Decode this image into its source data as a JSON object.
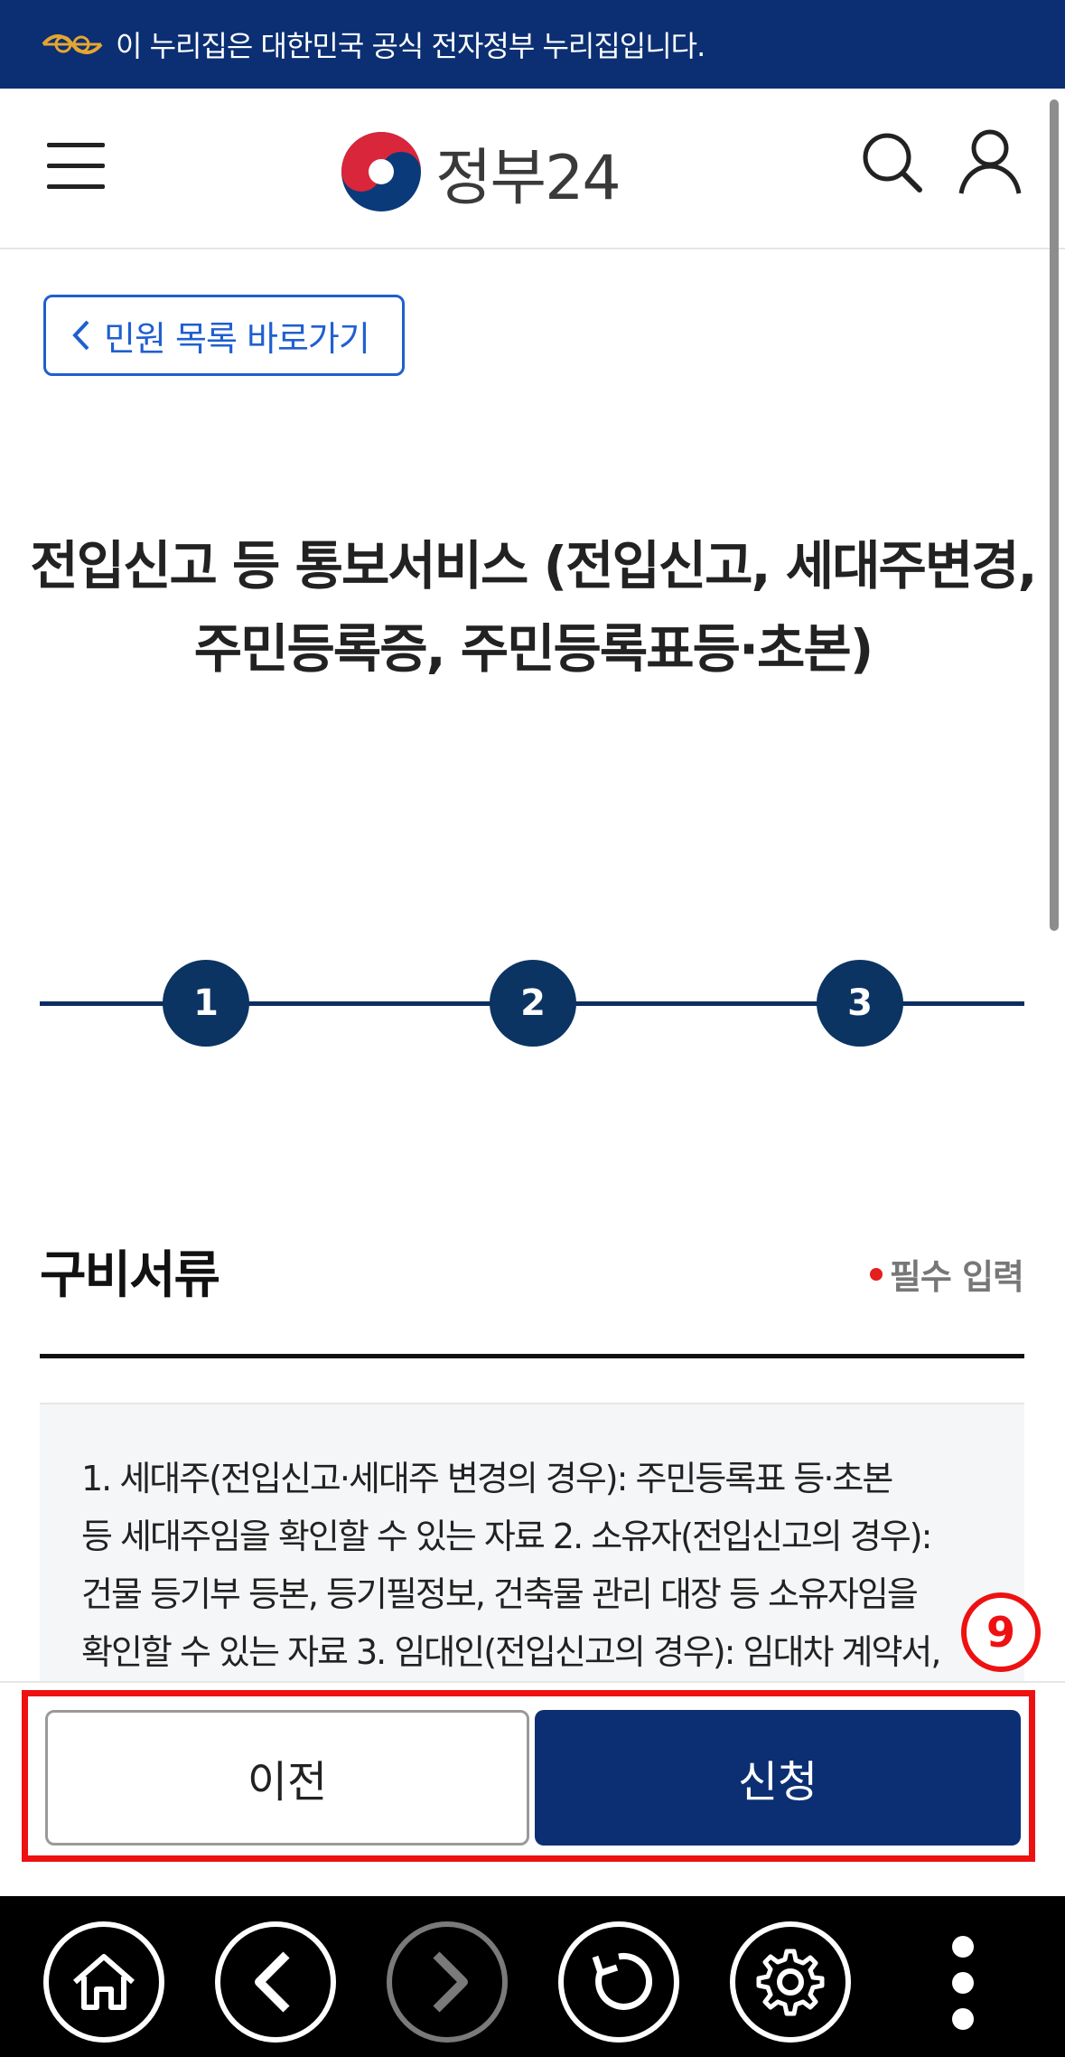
{
  "banner": {
    "text": "이 누리집은 대한민국 공식 전자정부 누리집입니다."
  },
  "header": {
    "logo_text": "정부24"
  },
  "back_link": {
    "label": "민원 목록 바로가기"
  },
  "page": {
    "title_line1": "전입신고 등 통보서비스 (전입신고, 세대주변경,",
    "title_line2": "주민등록증, 주민등록표등·초본)"
  },
  "steps": [
    "1",
    "2",
    "3"
  ],
  "section": {
    "title": "구비서류",
    "required_label": "필수 입력",
    "doc_lines": [
      "1. 세대주(전입신고·세대주 변경의 경우): 주민등록표 등·초본",
      "등 세대주임을 확인할 수 있는 자료 2. 소유자(전입신고의 경우):",
      "건물 등기부 등본, 등기필정보, 건축물 관리 대장 등 소유자임을",
      "확인할 수 있는 자료 3. 임대인(전입신고의 경우): 임대차 계약서,"
    ]
  },
  "annotation": {
    "badge": "9"
  },
  "actions": {
    "prev_label": "이전",
    "apply_label": "신청"
  },
  "colors": {
    "navy": "#0b2f72",
    "link_blue": "#1f5fd0",
    "highlight_red": "#ee1111"
  }
}
